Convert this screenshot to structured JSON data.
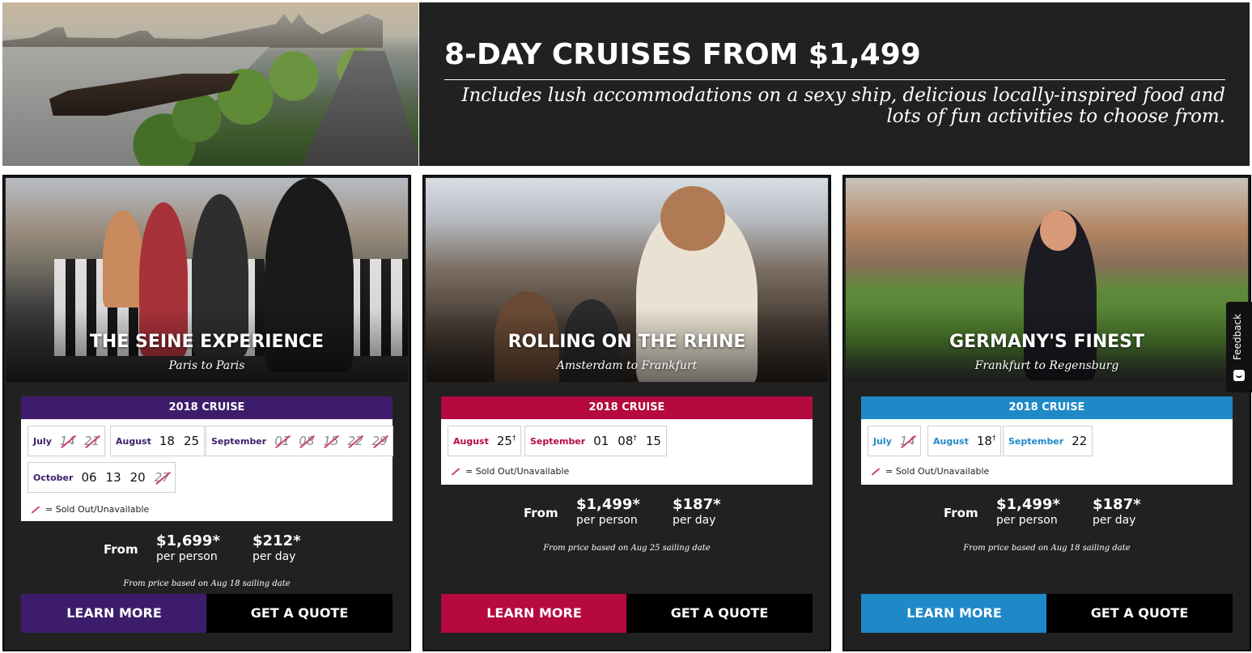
{
  "hero": {
    "title": "8-DAY CRUISES FROM $1,499",
    "subtitle": "Includes lush accommodations on a sexy ship, delicious locally-inspired food and lots of fun activities to choose from."
  },
  "legend_text": "= Sold Out/Unavailable",
  "cards": [
    {
      "title": "THE SEINE EXPERIENCE",
      "route": "Paris to Paris",
      "accent": "#3d1d6b",
      "cruise_label": "2018 CRUISE",
      "months": [
        {
          "name": "July",
          "days": [
            {
              "d": "14",
              "sold_out": true
            },
            {
              "d": "21",
              "sold_out": true
            }
          ]
        },
        {
          "name": "August",
          "days": [
            {
              "d": "18",
              "sold_out": false
            },
            {
              "d": "25",
              "sold_out": false
            }
          ]
        },
        {
          "name": "September",
          "days": [
            {
              "d": "01",
              "sold_out": true
            },
            {
              "d": "08",
              "sold_out": true
            },
            {
              "d": "15",
              "sold_out": true
            },
            {
              "d": "22",
              "sold_out": true
            },
            {
              "d": "29",
              "sold_out": true
            }
          ]
        },
        {
          "name": "October",
          "days": [
            {
              "d": "06",
              "sold_out": false
            },
            {
              "d": "13",
              "sold_out": false
            },
            {
              "d": "20",
              "sold_out": false
            },
            {
              "d": "27",
              "sold_out": true
            }
          ]
        }
      ],
      "from_label": "From",
      "price_per_person": "$1,699*",
      "per_person_label": "per person",
      "price_per_day": "$212*",
      "per_day_label": "per day",
      "price_note": "From price based on Aug 18 sailing date",
      "learn_more": "LEARN MORE",
      "get_quote": "GET A QUOTE"
    },
    {
      "title": "ROLLING ON THE RHINE",
      "route": "Amsterdam to Frankfurt",
      "accent": "#b5093f",
      "cruise_label": "2018 CRUISE",
      "months": [
        {
          "name": "August",
          "days": [
            {
              "d": "25",
              "sold_out": false,
              "dagger": true
            }
          ]
        },
        {
          "name": "September",
          "days": [
            {
              "d": "01",
              "sold_out": false
            },
            {
              "d": "08",
              "sold_out": false,
              "dagger": true
            },
            {
              "d": "15",
              "sold_out": false
            }
          ]
        }
      ],
      "from_label": "From",
      "price_per_person": "$1,499*",
      "per_person_label": "per person",
      "price_per_day": "$187*",
      "per_day_label": "per day",
      "price_note": "From price based on Aug 25 sailing date",
      "learn_more": "LEARN MORE",
      "get_quote": "GET A QUOTE"
    },
    {
      "title": "GERMANY'S FINEST",
      "route": "Frankfurt to Regensburg",
      "accent": "#1f89c8",
      "cruise_label": "2018 CRUISE",
      "months": [
        {
          "name": "July",
          "days": [
            {
              "d": "14",
              "sold_out": true
            }
          ]
        },
        {
          "name": "August",
          "days": [
            {
              "d": "18",
              "sold_out": false,
              "dagger": true
            }
          ]
        },
        {
          "name": "September",
          "days": [
            {
              "d": "22",
              "sold_out": false
            }
          ]
        }
      ],
      "from_label": "From",
      "price_per_person": "$1,499*",
      "per_person_label": "per person",
      "price_per_day": "$187*",
      "per_day_label": "per day",
      "price_note": "From price based on Aug 18 sailing date",
      "learn_more": "LEARN MORE",
      "get_quote": "GET A QUOTE"
    }
  ],
  "feedback": {
    "label": "Feedback"
  }
}
